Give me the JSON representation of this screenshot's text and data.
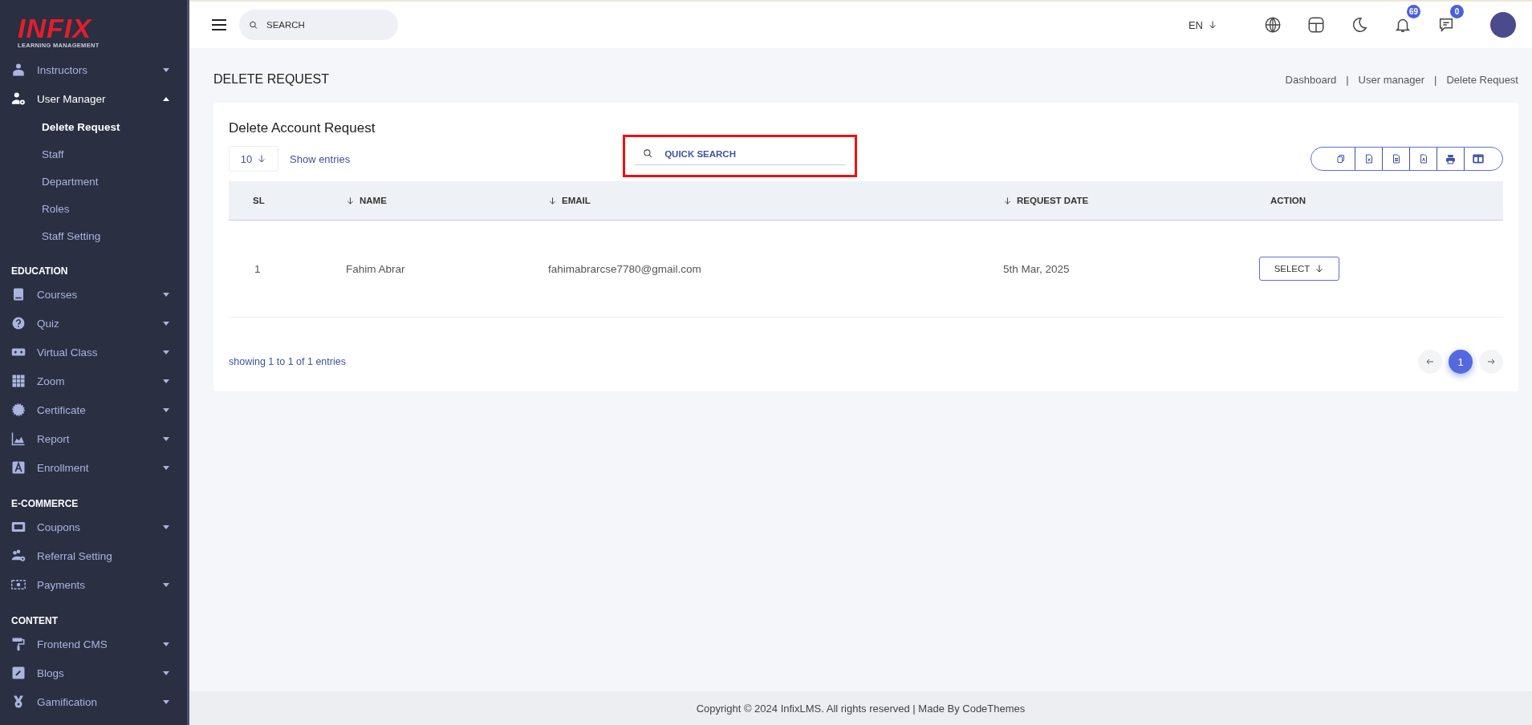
{
  "sidebar": {
    "logo": {
      "brand": "INFIX",
      "tagline": "LEARNING MANAGEMENT"
    },
    "sections": [
      {
        "items": [
          {
            "label": "Instructors",
            "expanded": false
          },
          {
            "label": "User Manager",
            "expanded": true,
            "children": [
              {
                "label": "Delete Request",
                "selected": true
              },
              {
                "label": "Staff",
                "selected": false
              },
              {
                "label": "Department",
                "selected": false
              },
              {
                "label": "Roles",
                "selected": false
              },
              {
                "label": "Staff Setting",
                "selected": false
              }
            ]
          }
        ]
      },
      {
        "heading": "EDUCATION",
        "items": [
          {
            "label": "Courses",
            "expanded": false
          },
          {
            "label": "Quiz",
            "expanded": false
          },
          {
            "label": "Virtual Class",
            "expanded": false
          },
          {
            "label": "Zoom",
            "expanded": false
          },
          {
            "label": "Certificate",
            "expanded": false
          },
          {
            "label": "Report",
            "expanded": false
          },
          {
            "label": "Enrollment",
            "expanded": false
          }
        ]
      },
      {
        "heading": "E-COMMERCE",
        "items": [
          {
            "label": "Coupons",
            "expanded": false
          },
          {
            "label": "Referral Setting"
          },
          {
            "label": "Payments",
            "expanded": false
          }
        ]
      },
      {
        "heading": "CONTENT",
        "items": [
          {
            "label": "Frontend CMS",
            "expanded": false
          },
          {
            "label": "Blogs",
            "expanded": false
          },
          {
            "label": "Gamification",
            "expanded": false
          }
        ]
      }
    ]
  },
  "header": {
    "search": {
      "placeholder": "SEARCH"
    },
    "language": "EN",
    "notifications": "69",
    "messages": "0"
  },
  "page": {
    "title": "DELETE REQUEST",
    "breadcrumb": [
      "Dashboard",
      "User manager",
      "Delete Request"
    ],
    "breadcrumb_separator": "|"
  },
  "card": {
    "title": "Delete Account Request",
    "entries": {
      "value": "10",
      "label": "Show entries"
    },
    "quick_search": {
      "placeholder": "QUICK SEARCH",
      "highlighted": true
    },
    "columns": [
      {
        "label": "SL",
        "sortable": false
      },
      {
        "label": "NAME",
        "sortable": true
      },
      {
        "label": "EMAIL",
        "sortable": true
      },
      {
        "label": "REQUEST DATE",
        "sortable": true
      },
      {
        "label": "ACTION",
        "sortable": false
      }
    ],
    "rows": [
      {
        "sl": "1",
        "name": "Fahim Abrar",
        "email": "fahimabrarcse7780@gmail.com",
        "date": "5th Mar, 2025",
        "action": "SELECT"
      }
    ],
    "info": "showing 1 to 1 of 1 entries",
    "pages": [
      {
        "label": "1",
        "selected": true
      }
    ]
  },
  "footer": "Copyright © 2024 InfixLMS. All rights reserved | Made By CodeThemes"
}
